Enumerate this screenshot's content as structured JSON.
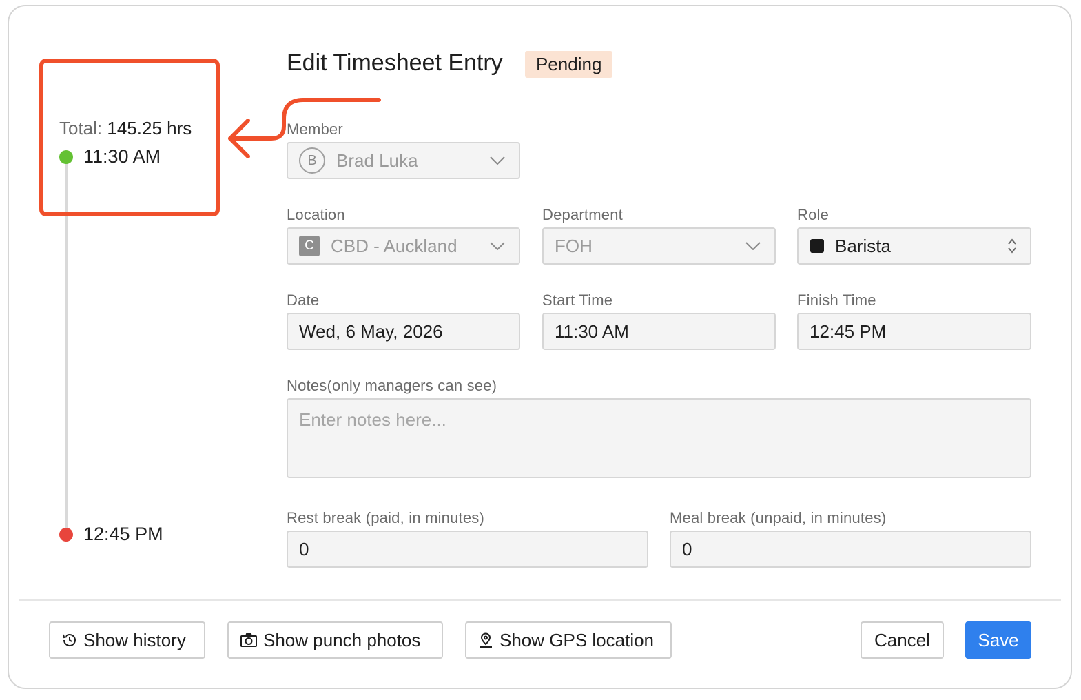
{
  "timeline": {
    "total_label": "Total:",
    "total_value": "145.25 hrs",
    "start_time": "11:30 AM",
    "end_time": "12:45 PM"
  },
  "header": {
    "title": "Edit Timesheet Entry",
    "status": "Pending"
  },
  "form": {
    "member": {
      "label": "Member",
      "avatar_letter": "B",
      "value": "Brad Luka"
    },
    "location": {
      "label": "Location",
      "icon_letter": "C",
      "value": "CBD - Auckland"
    },
    "department": {
      "label": "Department",
      "value": "FOH"
    },
    "role": {
      "label": "Role",
      "value": "Barista"
    },
    "date": {
      "label": "Date",
      "value": "Wed, 6 May, 2026"
    },
    "start_time": {
      "label": "Start Time",
      "value": "11:30 AM"
    },
    "finish_time": {
      "label": "Finish Time",
      "value": "12:45 PM"
    },
    "notes": {
      "label": "Notes(only managers can see)",
      "placeholder": "Enter notes here..."
    },
    "rest_break": {
      "label": "Rest break (paid, in minutes)",
      "value": "0"
    },
    "meal_break": {
      "label": "Meal break (unpaid, in minutes)",
      "value": "0"
    }
  },
  "footer": {
    "show_history": "Show history",
    "show_punch_photos": "Show punch photos",
    "show_gps": "Show GPS location",
    "cancel": "Cancel",
    "save": "Save"
  },
  "colors": {
    "annotation": "#f0502b",
    "badge_bg": "#fbe3d3",
    "primary": "#2f80ed",
    "start_dot": "#63c133",
    "end_dot": "#e8453c"
  }
}
